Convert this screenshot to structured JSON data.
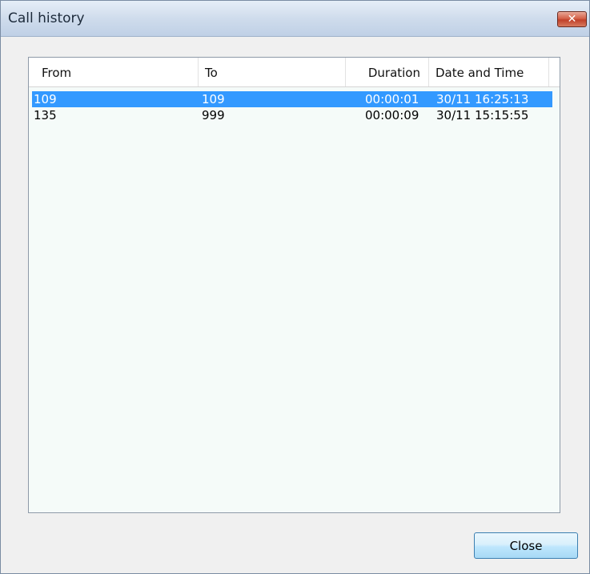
{
  "window": {
    "title": "Call history",
    "close_icon": "close-icon"
  },
  "table": {
    "columns": [
      "From",
      "To",
      "Duration",
      "Date and Time"
    ],
    "rows": [
      {
        "from": "109",
        "to": "109",
        "duration": "00:00:01",
        "datetime": "30/11 16:25:13",
        "selected": true
      },
      {
        "from": "135",
        "to": "999",
        "duration": "00:00:09",
        "datetime": "30/11 15:15:55",
        "selected": false
      }
    ]
  },
  "footer": {
    "close_label": "Close"
  },
  "colors": {
    "selection": "#3399ff",
    "titlebar": "#cfdcec",
    "close_x": "#c0412a"
  }
}
